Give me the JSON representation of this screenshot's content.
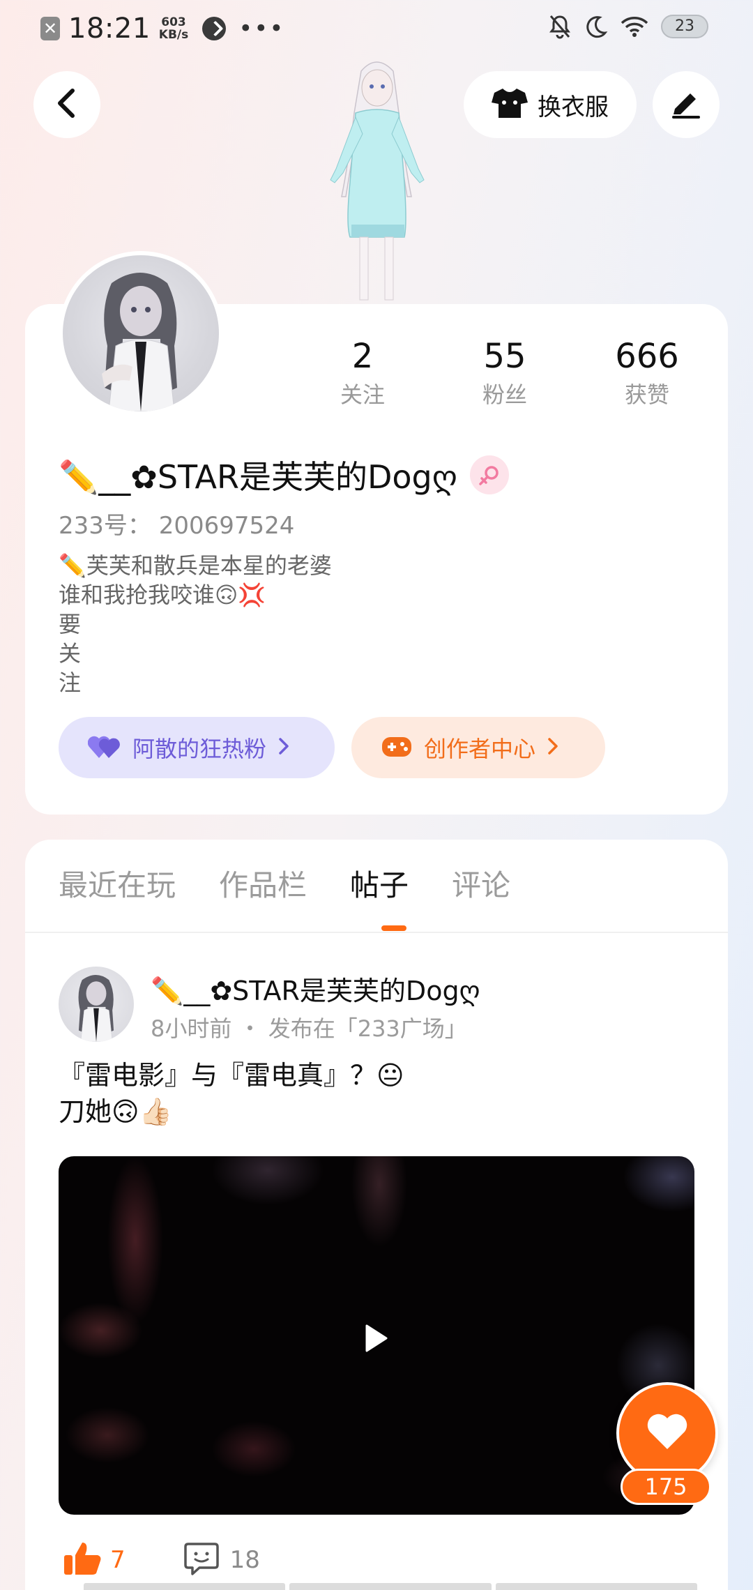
{
  "status_bar": {
    "time": "18:21",
    "speed_value": "603",
    "speed_unit": "KB/s",
    "more": "•••",
    "battery": "23"
  },
  "header": {
    "outfit_label": "换衣服"
  },
  "profile": {
    "stats": [
      {
        "value": "2",
        "label": "关注"
      },
      {
        "value": "55",
        "label": "粉丝"
      },
      {
        "value": "666",
        "label": "获赞"
      }
    ],
    "username": "✏️__✿STAR是芙芙的Dogღ",
    "account_id": "233号： 200697524",
    "bio": "✏️芙芙和散兵是本星的老婆\n谁和我抢我咬谁🙃💢\n要\n关\n注",
    "fan_label": "阿散的狂热粉",
    "creator_label": "创作者中心"
  },
  "tabs": [
    {
      "label": "最近在玩"
    },
    {
      "label": "作品栏"
    },
    {
      "label": "帖子"
    },
    {
      "label": "评论"
    }
  ],
  "post": {
    "author": "✏️__✿STAR是芙芙的Dogღ",
    "meta": "8小时前 ・ 发布在「233广场」",
    "text": "『雷电影』与『雷电真』？😐\n刀她🙃👍🏻",
    "likes": "7",
    "comments": "18"
  },
  "floating_like": {
    "count": "175"
  },
  "colors": {
    "accent": "#ff6a13",
    "fan_purple": "#6d5cd8",
    "fan_bg": "#e5e4fc",
    "creator_bg": "#feeadf"
  }
}
